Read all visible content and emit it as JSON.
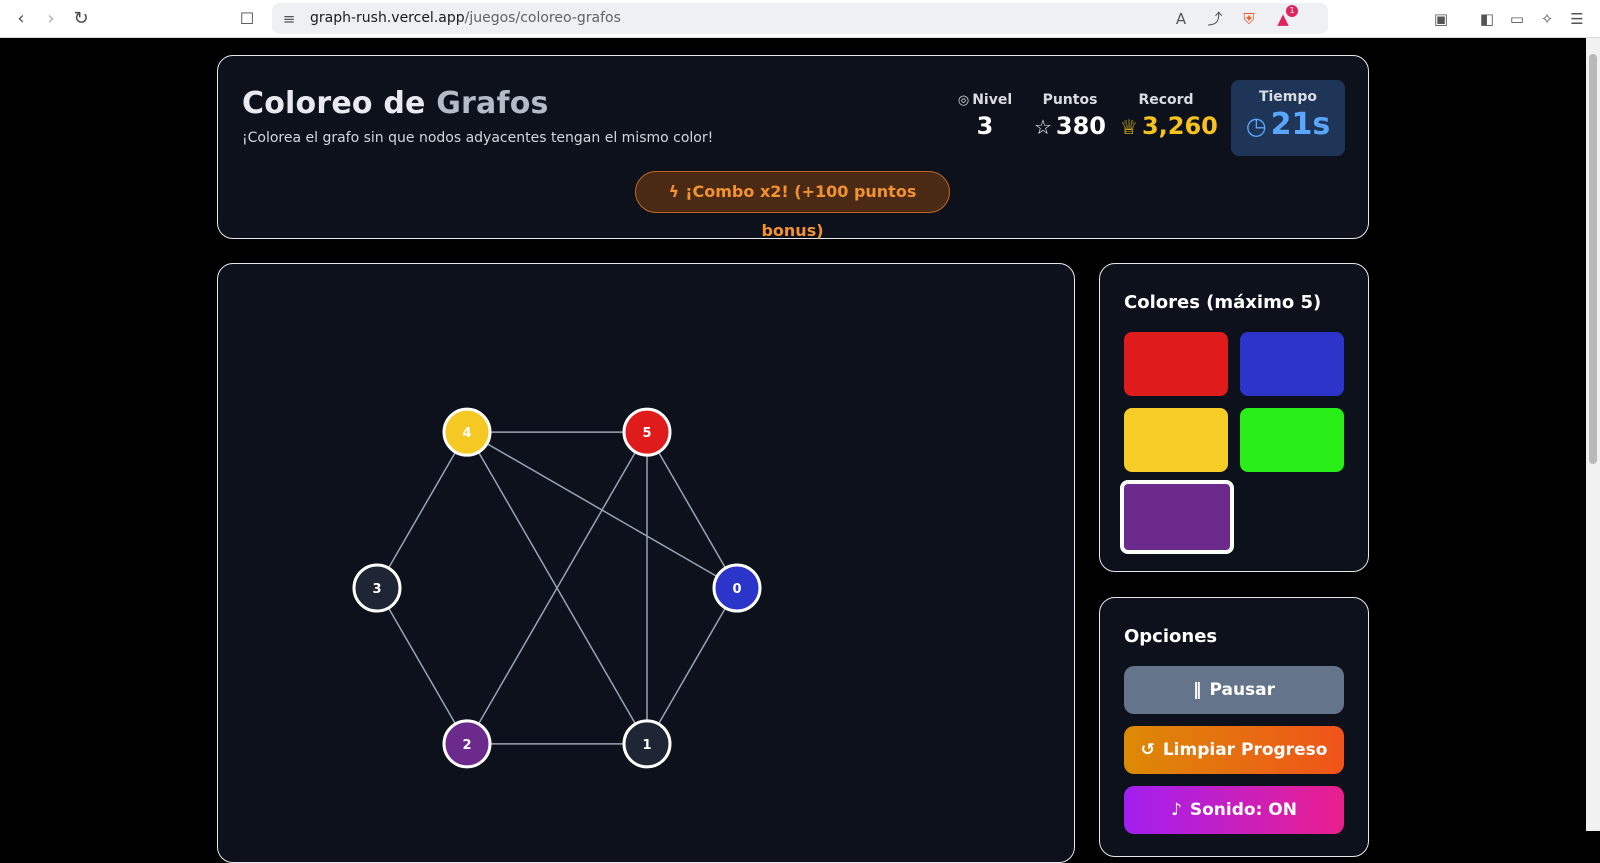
{
  "browser": {
    "url_host": "graph-rush.vercel.app",
    "url_path": "/juegos/coloreo-grafos",
    "notification_count": "1"
  },
  "header": {
    "title_part1": "Coloreo de ",
    "title_part2": "Grafos",
    "subtitle": "¡Colorea el grafo sin que nodos adyacentes tengan el mismo color!",
    "stats": {
      "nivel_label": "Nivel",
      "nivel_value": "3",
      "puntos_label": "Puntos",
      "puntos_value": "380",
      "record_label": "Record",
      "record_value": "3,260",
      "tiempo_label": "Tiempo",
      "tiempo_value": "21s"
    },
    "combo_text": "¡Combo x2! (+100 puntos bonus)"
  },
  "graph": {
    "nodes": [
      {
        "id": "0",
        "color": "#2b35c9"
      },
      {
        "id": "1",
        "color": "#1e2535"
      },
      {
        "id": "2",
        "color": "#6b2a8c"
      },
      {
        "id": "3",
        "color": "#1e2535"
      },
      {
        "id": "4",
        "color": "#f6c823"
      },
      {
        "id": "5",
        "color": "#e01b1b"
      }
    ],
    "edges": [
      [
        "4",
        "5"
      ],
      [
        "4",
        "3"
      ],
      [
        "4",
        "1"
      ],
      [
        "4",
        "0"
      ],
      [
        "5",
        "0"
      ],
      [
        "5",
        "1"
      ],
      [
        "5",
        "2"
      ],
      [
        "3",
        "2"
      ],
      [
        "2",
        "1"
      ],
      [
        "1",
        "0"
      ]
    ]
  },
  "palette": {
    "title": "Colores (máximo 5)",
    "colors": [
      "#e01b1b",
      "#2b35c9",
      "#f6cd26",
      "#2aee17",
      "#6b2a8c"
    ],
    "selected_index": 4
  },
  "options": {
    "title": "Opciones",
    "pause_label": "Pausar",
    "clear_label": "Limpiar Progreso",
    "sound_label": "Sonido: ON"
  }
}
